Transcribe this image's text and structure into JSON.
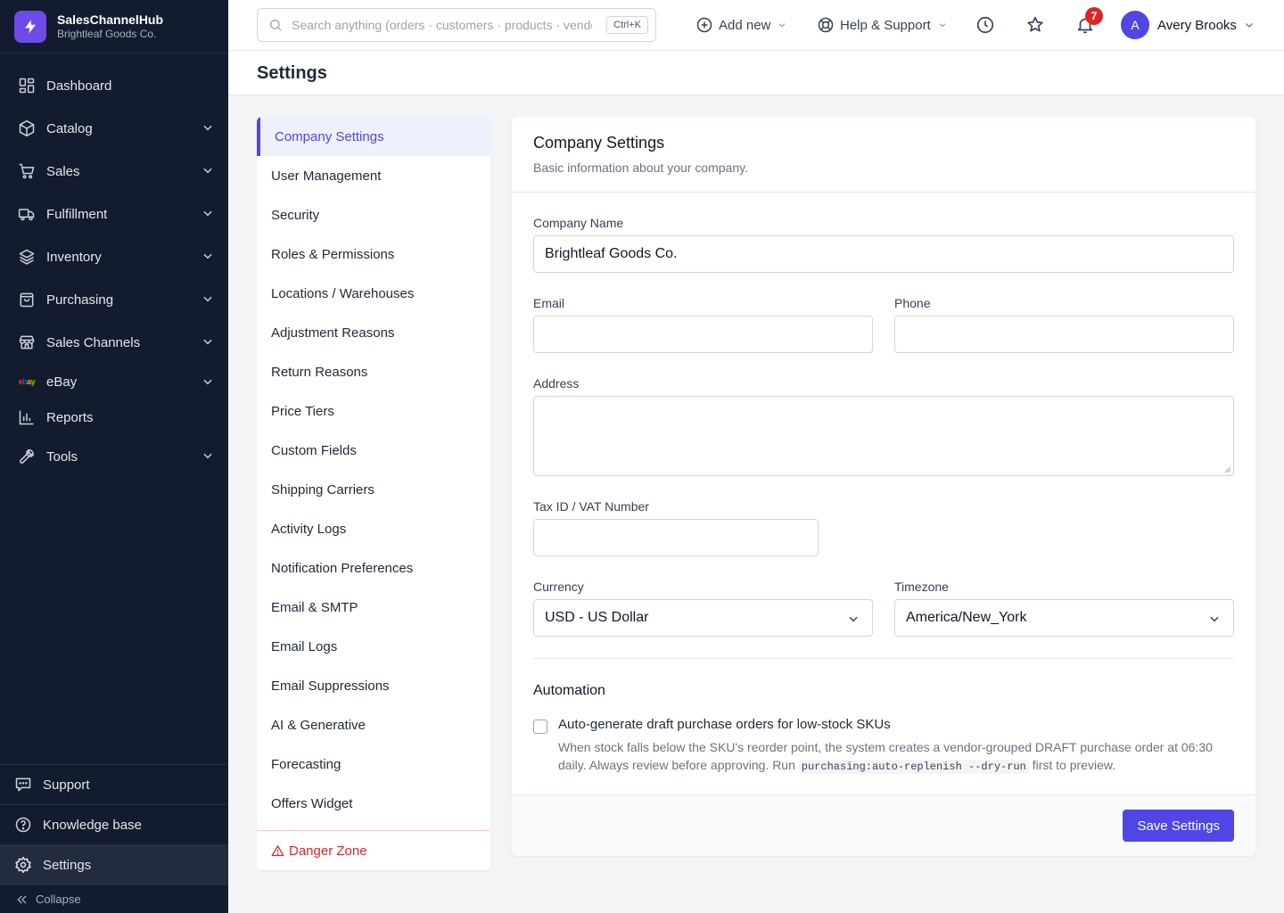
{
  "brand": {
    "name": "SalesChannelHub",
    "company": "Brightleaf Goods Co."
  },
  "sidebar": {
    "items": [
      {
        "label": "Dashboard",
        "icon": "dashboard-icon"
      },
      {
        "label": "Catalog",
        "icon": "box-icon",
        "expandable": true
      },
      {
        "label": "Sales",
        "icon": "cart-icon",
        "expandable": true
      },
      {
        "label": "Fulfillment",
        "icon": "truck-icon",
        "expandable": true
      },
      {
        "label": "Inventory",
        "icon": "layers-icon",
        "expandable": true
      },
      {
        "label": "Purchasing",
        "icon": "bag-icon",
        "expandable": true
      },
      {
        "label": "Sales Channels",
        "icon": "store-icon",
        "expandable": true
      },
      {
        "label": "eBay",
        "icon": "ebay-logo",
        "logo_text": "ebay",
        "expandable": true
      },
      {
        "label": "Reports",
        "icon": "bar-chart-icon"
      },
      {
        "label": "Tools",
        "icon": "wrench-icon",
        "expandable": true
      }
    ],
    "bottom": [
      {
        "label": "Support",
        "icon": "chat-icon"
      },
      {
        "label": "Knowledge base",
        "icon": "help-circle-icon"
      },
      {
        "label": "Settings",
        "icon": "gear-icon",
        "active": true
      }
    ],
    "collapse_label": "Collapse"
  },
  "topbar": {
    "search_placeholder": "Search anything (orders · customers · products · vendors)",
    "search_shortcut": "Ctrl+K",
    "add_new": "Add new",
    "help": "Help & Support",
    "notifications_count": "7",
    "user_name": "Avery Brooks",
    "user_initial": "A"
  },
  "page": {
    "title": "Settings"
  },
  "settings_nav": {
    "items": [
      "Company Settings",
      "User Management",
      "Security",
      "Roles & Permissions",
      "Locations / Warehouses",
      "Adjustment Reasons",
      "Return Reasons",
      "Price Tiers",
      "Custom Fields",
      "Shipping Carriers",
      "Activity Logs",
      "Notification Preferences",
      "Email & SMTP",
      "Email Logs",
      "Email Suppressions",
      "AI & Generative",
      "Forecasting",
      "Offers Widget"
    ],
    "active_index": 0,
    "danger_zone": "Danger Zone"
  },
  "form": {
    "title": "Company Settings",
    "description": "Basic information about your company.",
    "company_name_label": "Company Name",
    "company_name_value": "Brightleaf Goods Co.",
    "email_label": "Email",
    "email_value": "",
    "phone_label": "Phone",
    "phone_value": "",
    "address_label": "Address",
    "address_value": "",
    "tax_label": "Tax ID / VAT Number",
    "tax_value": "",
    "currency_label": "Currency",
    "currency_value": "USD - US Dollar",
    "timezone_label": "Timezone",
    "timezone_value": "America/New_York",
    "automation_title": "Automation",
    "auto_po_label": "Auto-generate draft purchase orders for low-stock SKUs",
    "auto_po_checked": false,
    "auto_po_help_1": "When stock falls below the SKU's reorder point, the system creates a vendor-grouped DRAFT purchase order at 06:30 daily. Always review before approving. Run ",
    "auto_po_help_code": "purchasing:auto-replenish --dry-run",
    "auto_po_help_2": " first to preview.",
    "save_label": "Save Settings"
  },
  "colors": {
    "sidebar_bg": "#131c2e",
    "accent": "#4f46e5",
    "brand_logo": "#6d4be8",
    "danger": "#dc2626",
    "badge": "#dc2626"
  }
}
